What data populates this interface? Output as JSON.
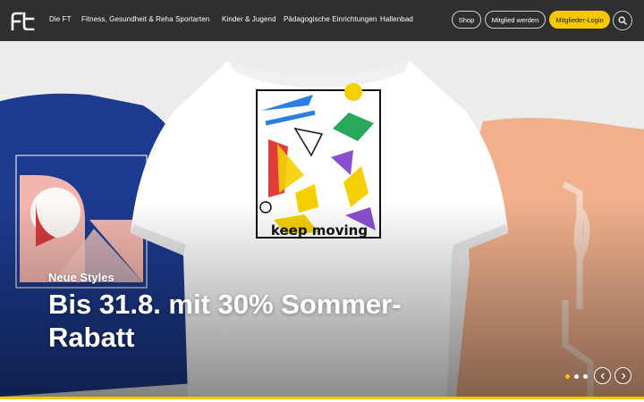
{
  "header": {
    "logo_icon": "ft-logo-icon",
    "nav": [
      {
        "label": "Die FT"
      },
      {
        "label": "Fitness, Gesundheit & Reha"
      },
      {
        "label": "Sportarten"
      },
      {
        "label": "Kinder & Jugend"
      },
      {
        "label": "Pädagogische Einrichtungen"
      },
      {
        "label": "Hallenbad"
      }
    ],
    "actions": {
      "shop": "Shop",
      "join": "Mitglied werden",
      "login": "Mitglieder-Login",
      "search_icon": "search-icon"
    }
  },
  "hero": {
    "eyebrow": "Neue Styles",
    "headline": "Bis 31.8. mit 30% Sommer-Rabatt",
    "shirt_print_text": "keep moving",
    "slider": {
      "active_index": 0,
      "total": 3,
      "prev_icon": "chevron-left-icon",
      "next_icon": "chevron-right-icon"
    }
  },
  "colors": {
    "header_bg": "#2f2f2f",
    "accent_yellow": "#f5c800",
    "shirt_blue": "#1c3a8f",
    "shirt_peach": "#f0b08c",
    "shirt_white": "#ffffff"
  }
}
